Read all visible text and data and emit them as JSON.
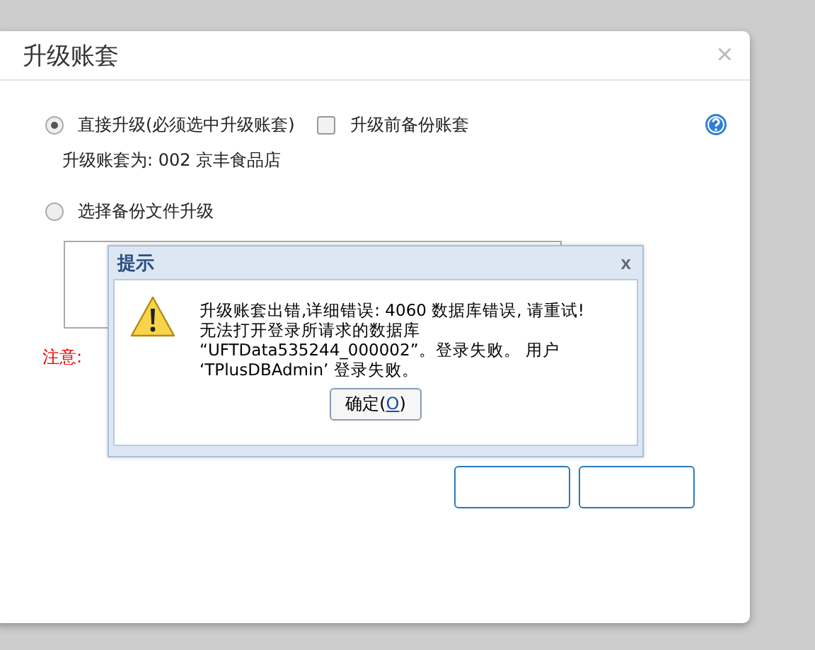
{
  "dialog": {
    "title": "升级账套",
    "close": "×",
    "options": [
      {
        "label": "直接升级(必须选中升级账套)",
        "selected": true
      },
      {
        "label": "选择备份文件升级",
        "selected": false
      }
    ],
    "backup_checkbox": {
      "label": "升级前备份账套",
      "checked": false
    },
    "account_line": "升级账套为: 002 京丰食品店",
    "note": "注意:"
  },
  "message_box": {
    "title": "提示",
    "close": "x",
    "lines": [
      "升级账套出错,详细错误: 4060 数据库错误, 请重试!",
      "无法打开登录所请求的数据库",
      "“UFTData535244_000002”。登录失败。 用户",
      "‘TPlusDBAdmin’ 登录失败。"
    ],
    "ok_button": {
      "prefix": "确定(",
      "key": "O",
      "suffix": ")"
    }
  }
}
